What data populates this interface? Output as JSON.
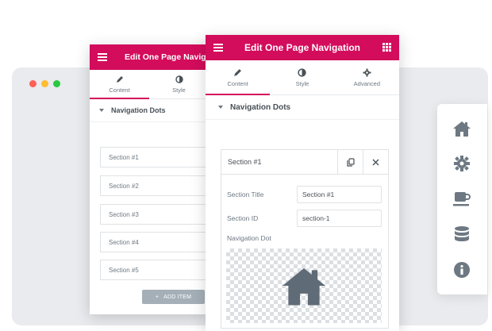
{
  "browser": {
    "dot_colors": [
      "#ff5f57",
      "#febc2e",
      "#28c840"
    ]
  },
  "back_panel": {
    "title": "Edit One Page Navigat",
    "tabs": [
      {
        "label": "Content",
        "icon": "pencil-icon"
      },
      {
        "label": "Style",
        "icon": "contrast-icon"
      }
    ],
    "section_title": "Navigation Dots",
    "items": [
      "Section #1",
      "Section #2",
      "Section #3",
      "Section #4",
      "Section #5"
    ],
    "add_item_label": "ADD ITEM"
  },
  "front_panel": {
    "title": "Edit One Page Navigation",
    "tabs": [
      {
        "label": "Content",
        "icon": "pencil-icon"
      },
      {
        "label": "Style",
        "icon": "contrast-icon"
      },
      {
        "label": "Advanced",
        "icon": "gear-icon"
      }
    ],
    "section_title": "Navigation Dots",
    "item": {
      "label": "Section #1",
      "fields": {
        "title_label": "Section Title",
        "title_value": "Section #1",
        "id_label": "Section ID",
        "id_value": "section-1",
        "dot_label": "Navigation Dot"
      },
      "dot_icon": "home-icon"
    }
  },
  "icon_widget": {
    "icons": [
      "home-icon",
      "gear-icon",
      "coffee-icon",
      "database-icon",
      "info-icon"
    ]
  },
  "colors": {
    "accent": "#d30c5c",
    "icon_gray": "#6d7882",
    "button_gray": "#a4afb7"
  }
}
